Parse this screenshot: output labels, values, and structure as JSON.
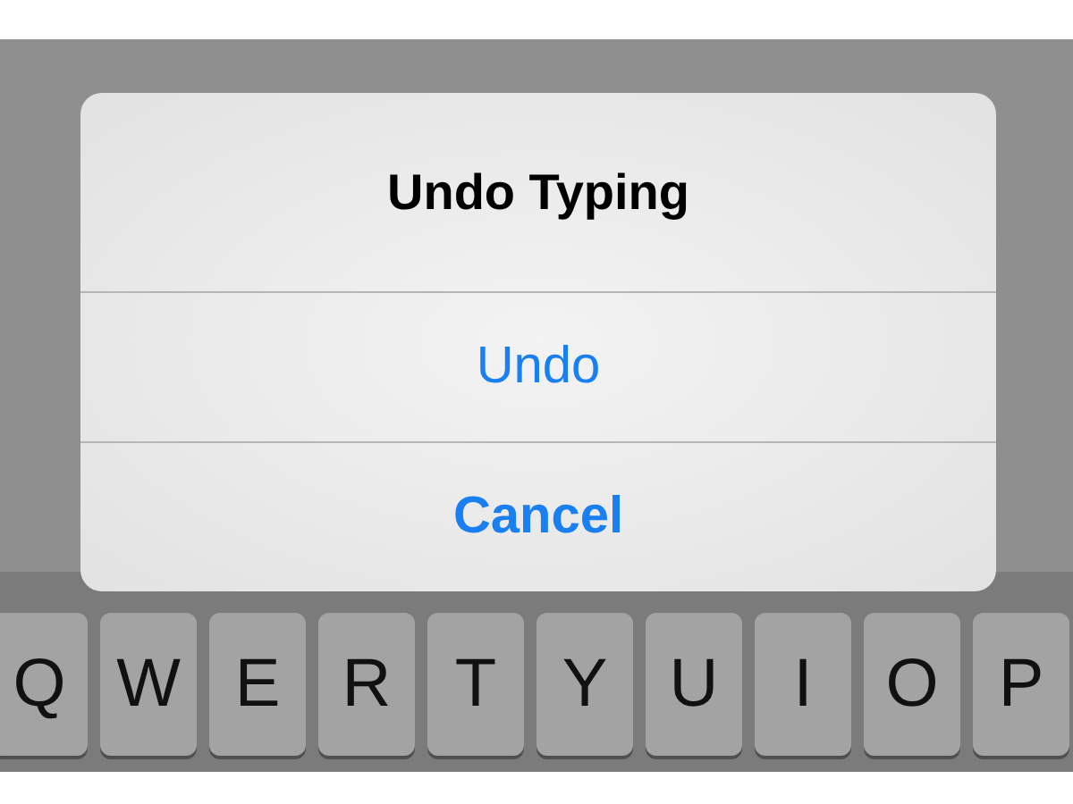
{
  "dialog": {
    "title": "Undo Typing",
    "actions": [
      {
        "label": "Undo",
        "kind": "default"
      },
      {
        "label": "Cancel",
        "kind": "cancel"
      }
    ]
  },
  "keyboard": {
    "keys": [
      "Q",
      "W",
      "E",
      "R",
      "T",
      "Y",
      "U",
      "I",
      "O",
      "P"
    ]
  }
}
